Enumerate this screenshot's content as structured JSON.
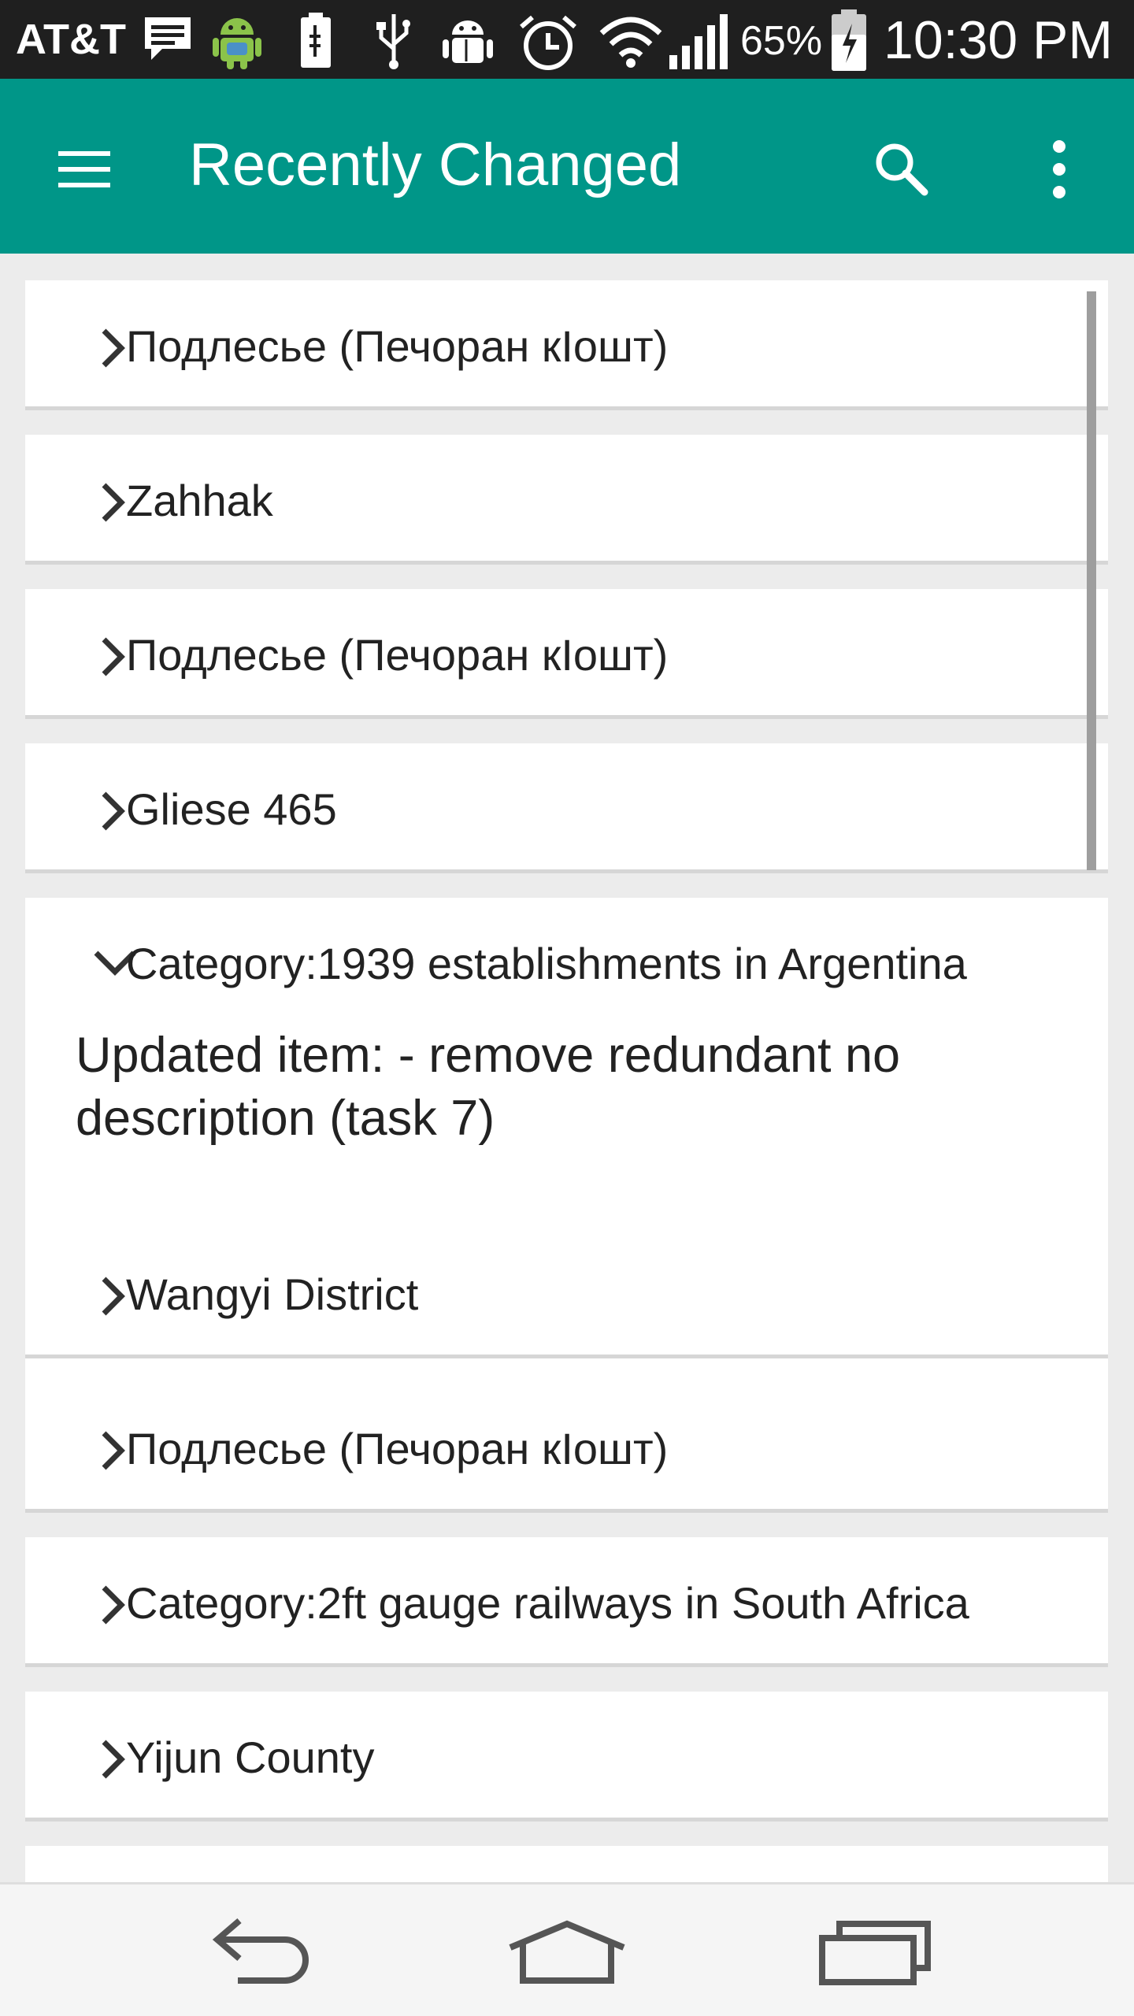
{
  "status_bar": {
    "carrier": "AT&T",
    "battery_percent": "65%",
    "time": "10:30 PM",
    "icons": [
      "message-icon",
      "android-icon",
      "battery-charging-icon",
      "usb-icon",
      "debug-icon",
      "alarm-icon",
      "wifi-icon",
      "signal-icon",
      "battery-icon"
    ]
  },
  "app_bar": {
    "title": "Recently Changed",
    "icons": [
      "menu-icon",
      "search-icon",
      "more-vert-icon"
    ],
    "color": "#009688"
  },
  "list": {
    "items": [
      {
        "label": "Подлесье (Печоран кIошт)",
        "expanded": false
      },
      {
        "label": "Zahhak",
        "expanded": false
      },
      {
        "label": "Подлесье (Печоран кIошт)",
        "expanded": false
      },
      {
        "label": "Gliese 465",
        "expanded": false
      },
      {
        "label": "Category:1939 establishments in Argentina",
        "expanded": true,
        "description": "Updated item:  - remove redundant no description (task 7)"
      },
      {
        "label": "Wangyi District",
        "expanded": false
      },
      {
        "label": "Подлесье (Печоран кIошт)",
        "expanded": false
      },
      {
        "label": "Category:2ft gauge railways in South Africa",
        "expanded": false
      },
      {
        "label": "Yijun County",
        "expanded": false
      }
    ]
  },
  "nav_bar": {
    "icons": [
      "back-icon",
      "home-icon",
      "recents-icon"
    ]
  }
}
